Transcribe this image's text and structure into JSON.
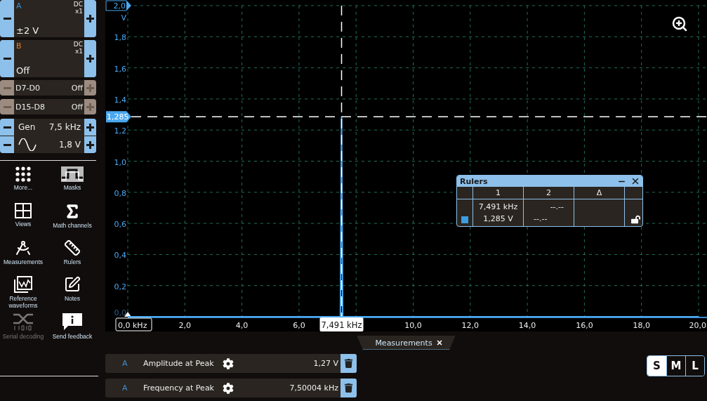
{
  "channels": [
    {
      "kind": "analog",
      "name": "A",
      "color": "#3d8fd6",
      "coupling": "DC",
      "probe": "x1",
      "range": "±2 V"
    },
    {
      "kind": "analog",
      "name": "B",
      "color": "#e07a3a",
      "coupling": "DC",
      "probe": "x1",
      "range": "Off"
    },
    {
      "kind": "digital",
      "name": "D7-D0",
      "range": "Off"
    },
    {
      "kind": "digital",
      "name": "D15-D8",
      "range": "Off"
    }
  ],
  "generator": {
    "label": "Gen",
    "frequency": "7,5 kHz",
    "amplitude": "1,8 V"
  },
  "tools": [
    {
      "label": "More...",
      "disabled": false
    },
    {
      "label": "Masks",
      "disabled": false
    },
    {
      "label": "Views",
      "disabled": false
    },
    {
      "label": "Math channels",
      "disabled": false
    },
    {
      "label": "Measurements",
      "disabled": false
    },
    {
      "label": "Rulers",
      "disabled": false
    },
    {
      "label": "Reference waveforms",
      "disabled": false
    },
    {
      "label": "Notes",
      "disabled": false
    },
    {
      "label": "Serial decoding",
      "disabled": true
    },
    {
      "label": "Send feedback",
      "disabled": false
    }
  ],
  "chart": {
    "chart_data": {
      "type": "line",
      "ylabel": "V",
      "x": [
        0,
        7.45,
        7.491,
        7.53,
        20
      ],
      "series": [
        {
          "color": "#4aa8f0",
          "values": [
            0,
            0,
            1.285,
            0,
            0
          ]
        }
      ],
      "grid": true,
      "xlim": [
        0,
        20
      ],
      "ylim": [
        0,
        2
      ],
      "xticks": [
        {
          "value": 0,
          "label": "0,0 kHz"
        },
        {
          "value": 2,
          "label": "2,0"
        },
        {
          "value": 4,
          "label": "4,0"
        },
        {
          "value": 6,
          "label": "6,0"
        },
        {
          "value": 10,
          "label": "10,0"
        },
        {
          "value": 12,
          "label": "12,0"
        },
        {
          "value": 14,
          "label": "14,0"
        },
        {
          "value": 16,
          "label": "16,0"
        },
        {
          "value": 18,
          "label": "18,0"
        },
        {
          "value": 20,
          "label": "20,0"
        }
      ],
      "yticks": [
        {
          "value": 0,
          "label": "0,0"
        },
        {
          "value": 0.2,
          "label": "0,2"
        },
        {
          "value": 0.4,
          "label": "0,4"
        },
        {
          "value": 0.6,
          "label": "0,6"
        },
        {
          "value": 0.8,
          "label": "0,8"
        },
        {
          "value": 1,
          "label": "1,0"
        },
        {
          "value": 1.2,
          "label": "1,2"
        },
        {
          "value": 1.4,
          "label": "1,4"
        },
        {
          "value": 1.6,
          "label": "1,6"
        },
        {
          "value": 1.8,
          "label": "1,8"
        },
        {
          "value": 2,
          "label": "2,0"
        }
      ],
      "ref_lines": [
        {
          "axis": "x",
          "value": 7.491,
          "label": "7,491 kHz"
        },
        {
          "axis": "y",
          "value": 1.285,
          "label": "1,285"
        }
      ]
    }
  },
  "rulers_panel": {
    "title": "Rulers",
    "columns": [
      "1",
      "2",
      "Δ"
    ],
    "rows": [
      {
        "values": [
          "7,491 kHz",
          "--.--"
        ]
      },
      {
        "color": "#3a9ee0",
        "values": [
          "1,285 V",
          "--.--"
        ],
        "locked": false
      }
    ]
  },
  "measurements_tab": {
    "label": "Measurements"
  },
  "measurements": [
    {
      "channel": "A",
      "name": "Amplitude at Peak",
      "value": "1,27 V"
    },
    {
      "channel": "A",
      "name": "Frequency at Peak",
      "value": "7,50004 kHz"
    }
  ],
  "size_toggle": [
    {
      "label": "S",
      "selected": true
    },
    {
      "label": "M",
      "selected": false
    },
    {
      "label": "L",
      "selected": false
    }
  ]
}
